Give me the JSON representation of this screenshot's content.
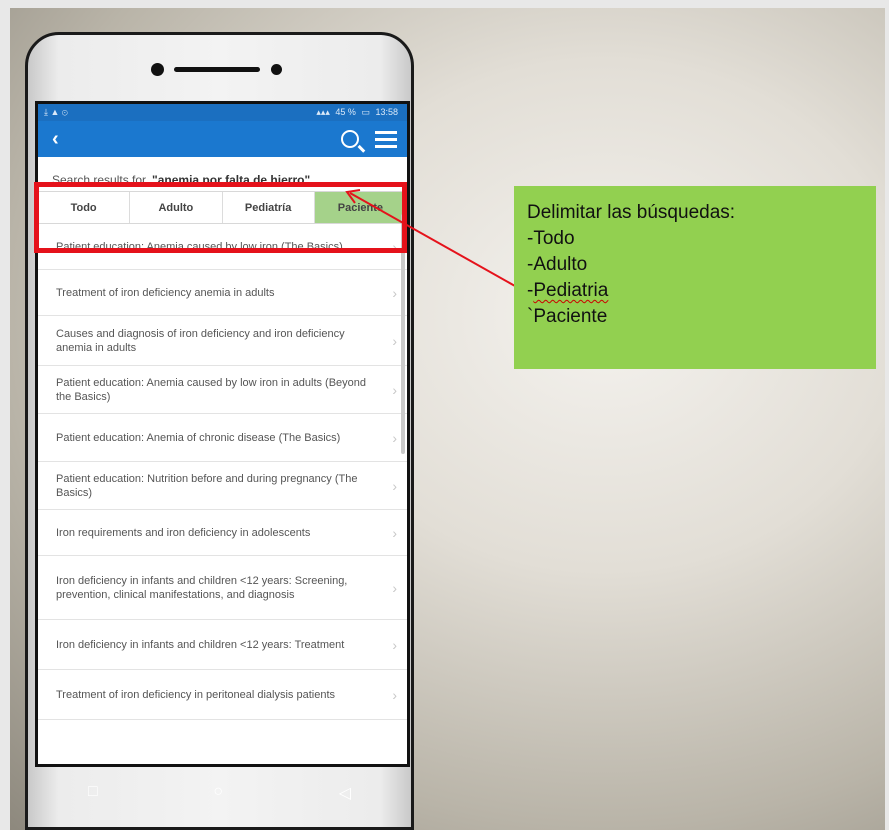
{
  "status_bar": {
    "left_icons": "⤓ ▲ ⊙",
    "right_text": "45 %",
    "time": "13:58"
  },
  "app_bar": {
    "back_glyph": "‹",
    "search_icon": "search-icon",
    "menu_icon": "menu-icon"
  },
  "search": {
    "prefix": "Search results for",
    "query": "\"anemia por falta de hierro\""
  },
  "tabs": [
    {
      "label": "Todo",
      "active": false
    },
    {
      "label": "Adulto",
      "active": false
    },
    {
      "label": "Pediatría",
      "active": false
    },
    {
      "label": "Paciente",
      "active": true
    }
  ],
  "results": [
    "Patient education: Anemia caused by low iron (The Basics)",
    "Treatment of iron deficiency anemia in adults",
    "Causes and diagnosis of iron deficiency and iron deficiency anemia in adults",
    "Patient education: Anemia caused by low iron in adults (Beyond the Basics)",
    "Patient education: Anemia of chronic disease (The Basics)",
    "Patient education: Nutrition before and during pregnancy (The Basics)",
    "Iron requirements and iron deficiency in adolescents",
    "Iron deficiency in infants and children <12 years: Screening, prevention, clinical manifestations, and diagnosis",
    "Iron deficiency in infants and children <12 years: Treatment",
    "Treatment of iron deficiency in peritoneal dialysis patients"
  ],
  "nav_buttons": [
    "□",
    "○",
    "◁"
  ],
  "callout": {
    "title": "Delimitar las búsquedas:",
    "line1": "-Todo",
    "line2": "-Adulto",
    "line3_dash": "-",
    "line3_word": "Pediatria",
    "line4": "`Paciente"
  },
  "colors": {
    "app_bar": "#1b78cf",
    "active_tab": "#a5d28a",
    "highlight": "#e5121b",
    "callout_bg": "#92d050"
  }
}
